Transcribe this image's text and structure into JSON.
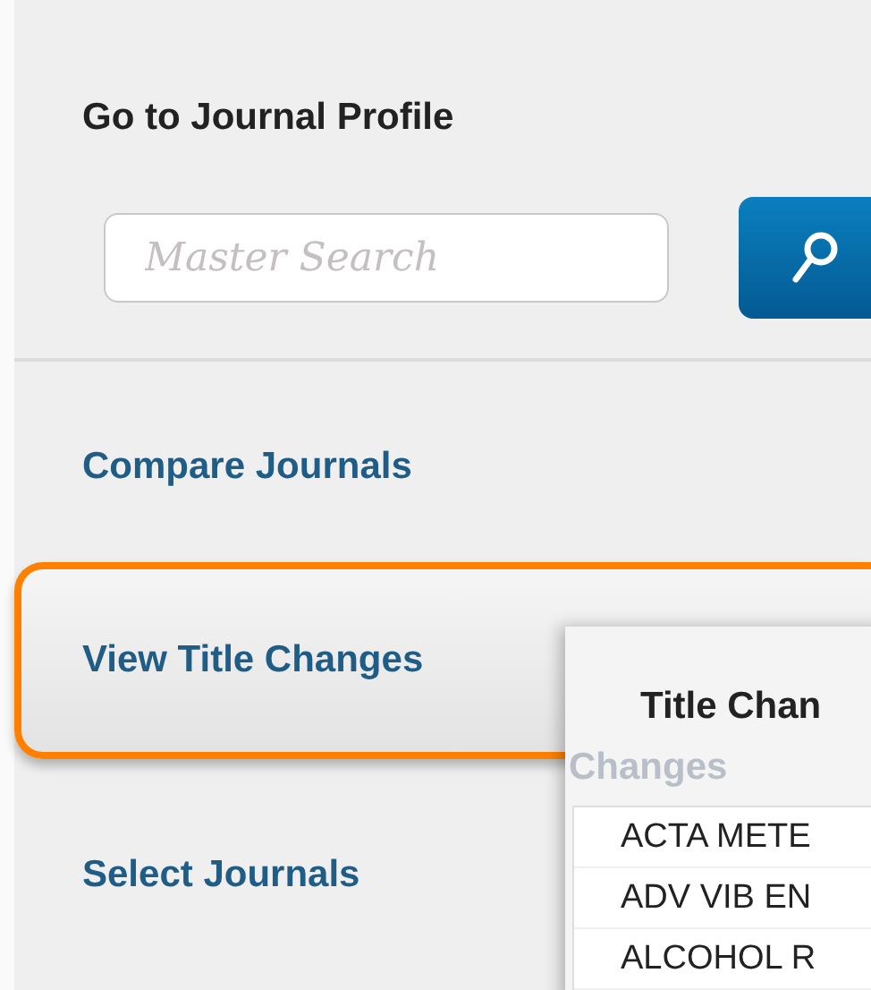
{
  "profile": {
    "heading": "Go to Journal Profile",
    "search": {
      "placeholder": "Master Search"
    }
  },
  "nav": [
    {
      "label": "Compare Journals",
      "selected": false
    },
    {
      "label": "View Title Changes",
      "selected": true
    },
    {
      "label": "Select Journals",
      "selected": false
    }
  ],
  "popup": {
    "title": "Title Chan",
    "subtitle": "Changes",
    "rows": [
      "ACTA METE",
      "ADV VIB EN",
      "ALCOHOL R"
    ]
  }
}
